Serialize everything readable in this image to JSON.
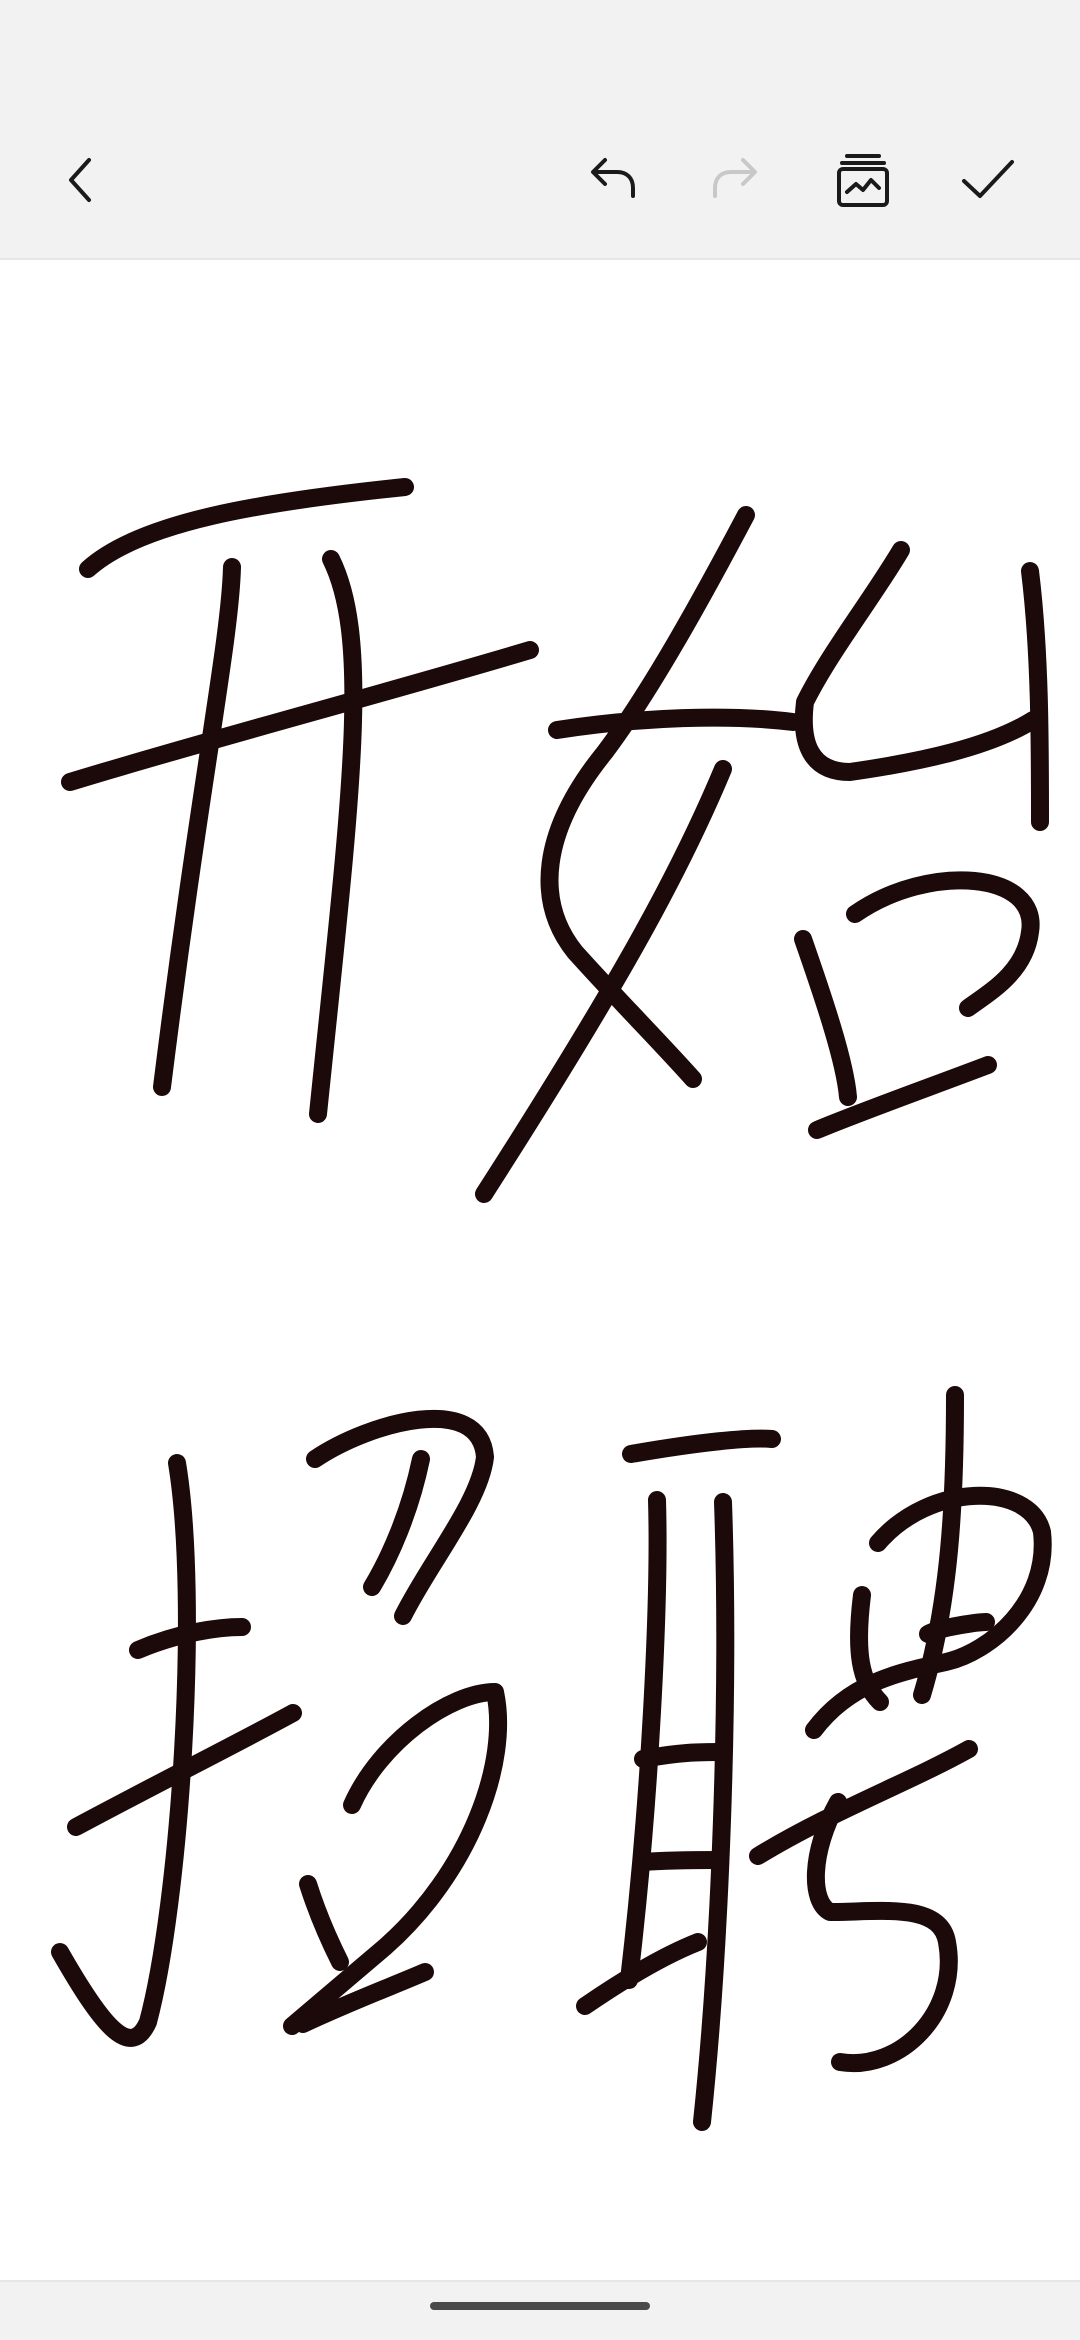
{
  "toolbar": {
    "buttons": [
      {
        "id": "back",
        "icon": "chevron-left-icon",
        "enabled": true
      },
      {
        "id": "undo",
        "icon": "undo-icon",
        "enabled": true
      },
      {
        "id": "redo",
        "icon": "redo-icon",
        "enabled": false
      },
      {
        "id": "layers",
        "icon": "layers-icon",
        "enabled": true
      },
      {
        "id": "confirm",
        "icon": "checkmark-icon",
        "enabled": true
      }
    ]
  },
  "colors": {
    "background": "#f2f2f2",
    "canvas": "#ffffff",
    "ink": "#1c0a0a",
    "icon": "#1a1a1a",
    "icon_disabled": "#c8c8c8"
  }
}
